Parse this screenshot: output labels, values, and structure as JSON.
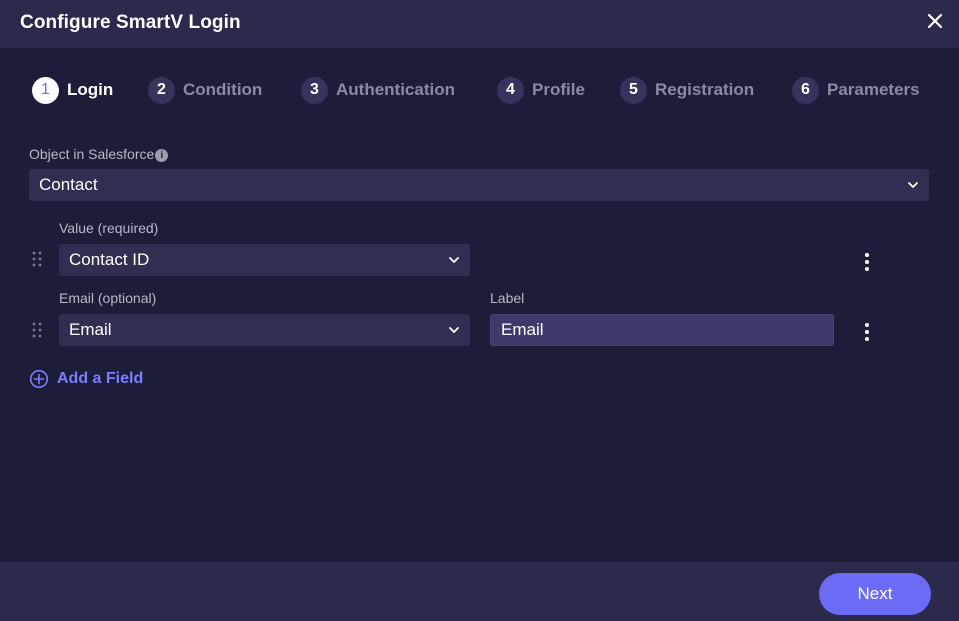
{
  "dialog": {
    "title": "Configure SmartV Login"
  },
  "steps": [
    {
      "number": "1",
      "label": "Login",
      "active": true
    },
    {
      "number": "2",
      "label": "Condition",
      "active": false
    },
    {
      "number": "3",
      "label": "Authentication",
      "active": false
    },
    {
      "number": "4",
      "label": "Profile",
      "active": false
    },
    {
      "number": "5",
      "label": "Registration",
      "active": false
    },
    {
      "number": "6",
      "label": "Parameters",
      "active": false
    }
  ],
  "object_field": {
    "label": "Object in Salesforce",
    "info_icon": "info-icon",
    "value": "Contact"
  },
  "fields": [
    {
      "label": "Value (required)",
      "value": "Contact ID"
    },
    {
      "label": "Email (optional)",
      "value": "Email",
      "label_field_label": "Label",
      "label_field_value": "Email"
    }
  ],
  "add_field": {
    "label": "Add a Field",
    "icon": "plus-circle-icon"
  },
  "footer": {
    "next_label": "Next"
  },
  "colors": {
    "background": "#1c1d38",
    "header": "#2b2a4c",
    "accent": "#6b6bf5",
    "link": "#7d7dff"
  }
}
